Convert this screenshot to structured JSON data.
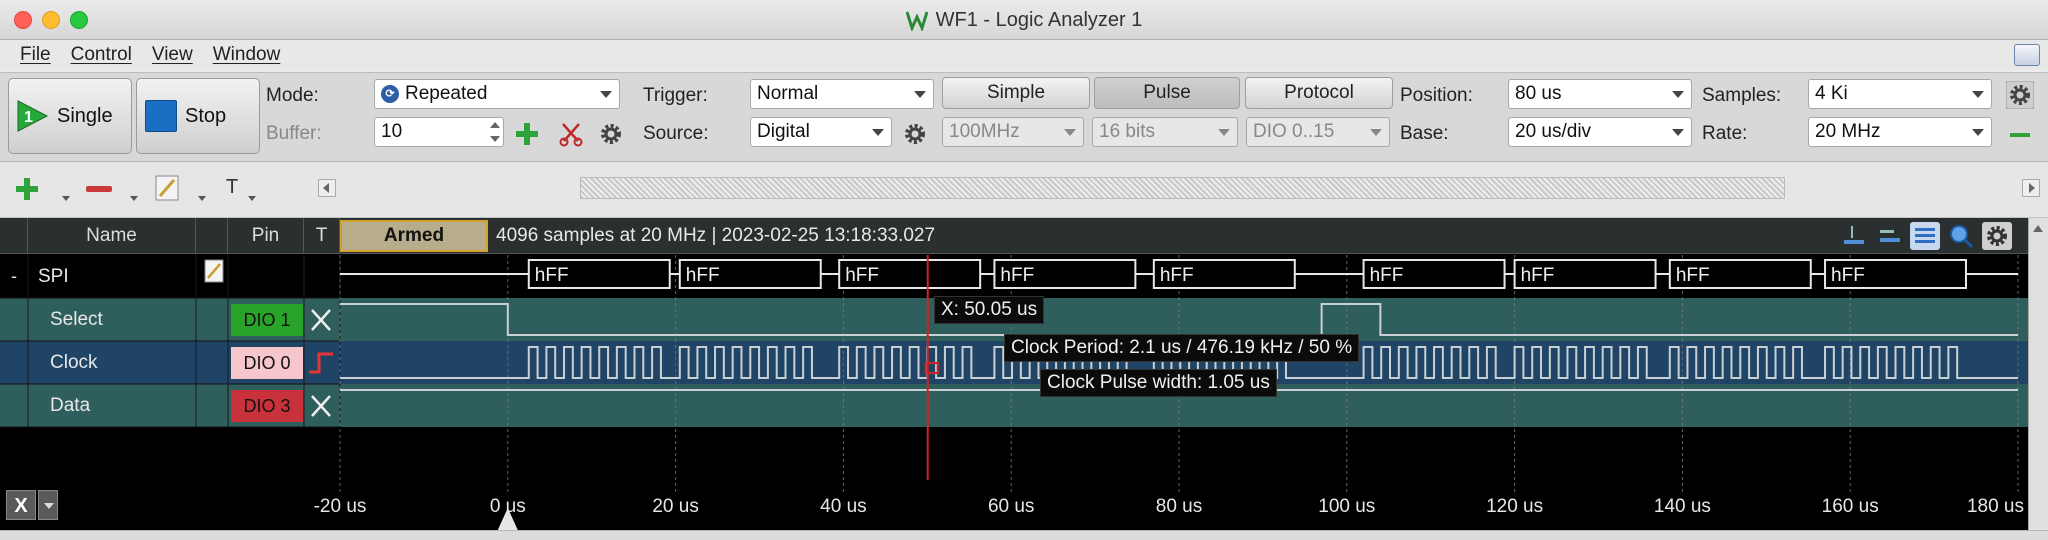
{
  "window": {
    "title": "WF1 - Logic Analyzer 1"
  },
  "menu": [
    "File",
    "Control",
    "View",
    "Window"
  ],
  "toolbar": {
    "single_label": "Single",
    "stop_label": "Stop",
    "mode_label": "Mode:",
    "mode_value": "Repeated",
    "buffer_label": "Buffer:",
    "buffer_value": "10",
    "trigger_label": "Trigger:",
    "trigger_value": "Normal",
    "source_label": "Source:",
    "source_value": "Digital",
    "simple_label": "Simple",
    "pulse_label": "Pulse",
    "protocol_label": "Protocol",
    "rate_combo_value": "100MHz",
    "bits_value": "16 bits",
    "dio_range_value": "DIO 0..15",
    "position_label": "Position:",
    "position_value": "80 us",
    "base_label": "Base:",
    "base_value": "20 us/div",
    "samples_label": "Samples:",
    "samples_value": "4 Ki",
    "rate_label": "Rate:",
    "rate_value": "20 MHz"
  },
  "toolbar2": {
    "text_tool_label": "T"
  },
  "analyzer": {
    "headers": {
      "name": "Name",
      "pin": "Pin",
      "trigger": "T"
    },
    "armed": "Armed",
    "status": "4096 samples at 20 MHz | 2023-02-25 13:18:33.027",
    "bus": {
      "expand": "-",
      "name": "SPI",
      "values": [
        "hFF",
        "hFF",
        "hFF",
        "hFF",
        "hFF",
        "hFF",
        "hFF",
        "hFF",
        "hFF"
      ]
    },
    "signals": [
      {
        "name": "Select",
        "pin": "DIO  1",
        "pin_color": "#2aa32a",
        "trigger": "X",
        "row_color": "#2f5f5c"
      },
      {
        "name": "Clock",
        "pin": "DIO  0",
        "pin_color": "#f6c6cc",
        "trigger": "rise",
        "row_color": "#1f4466"
      },
      {
        "name": "Data",
        "pin": "DIO  3",
        "pin_color": "#c9323a",
        "trigger": "X",
        "row_color": "#2f5f5c"
      }
    ],
    "cursor": {
      "x_label": "X: 50.05 us",
      "time_us": 50.05
    },
    "measurements": {
      "period": "Clock Period: 2.1 us / 476.19 kHz / 50 %",
      "pulse": "Clock Pulse width: 1.05 us"
    },
    "axis_ticks": [
      "-20 us",
      "0 us",
      "20 us",
      "40 us",
      "60 us",
      "80 us",
      "100 us",
      "120 us",
      "140 us",
      "160 us",
      "180 us"
    ],
    "axis_x_start_us": -20,
    "axis_x_end_us": 180,
    "trigger_marker_us": 0,
    "close_label": "X"
  },
  "colors": {
    "accent": "#d4a22a",
    "cursor": "#d22222",
    "trace": "#c8d0d4",
    "grid": "#7a7a7a"
  }
}
